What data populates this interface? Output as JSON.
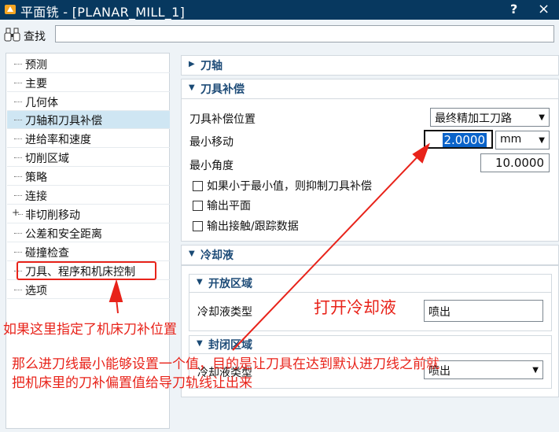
{
  "window": {
    "title": "平面铣 - [PLANAR_MILL_1]",
    "help_label": "?",
    "close_label": "×"
  },
  "find": {
    "label": "查找",
    "value": ""
  },
  "nav": {
    "items": [
      {
        "label": "预测"
      },
      {
        "label": "主要"
      },
      {
        "label": "几何体"
      },
      {
        "label": "刀轴和刀具补偿",
        "selected": true
      },
      {
        "label": "进给率和速度"
      },
      {
        "label": "切削区域"
      },
      {
        "label": "策略"
      },
      {
        "label": "连接"
      },
      {
        "label": "非切削移动",
        "expandable": true
      },
      {
        "label": "公差和安全距离"
      },
      {
        "label": "碰撞检查"
      },
      {
        "label": "刀具、程序和机床控制"
      },
      {
        "label": "选项"
      }
    ]
  },
  "sections": {
    "tool_axis": {
      "title": "刀轴"
    },
    "tool_comp": {
      "title": "刀具补偿",
      "position_label": "刀具补偿位置",
      "position_value": "最终精加工刀路",
      "min_move_label": "最小移动",
      "min_move_value": "2.0000",
      "min_move_unit": "mm",
      "min_angle_label": "最小角度",
      "min_angle_value": "10.0000",
      "check1": "如果小于最小值，则抑制刀具补偿",
      "check2": "输出平面",
      "check3": "输出接触/跟踪数据"
    },
    "coolant": {
      "title": "冷却液",
      "open_area": {
        "title": "开放区域",
        "type_label": "冷却液类型",
        "type_value": "喷出"
      },
      "closed_area": {
        "title": "封闭区域",
        "type_label": "冷却液类型",
        "type_value": "喷出"
      }
    }
  },
  "annotations": {
    "note1": "打开冷却液",
    "note2": "如果这里指定了机床刀补位置",
    "note3": "那么进刀线最小能够设置一个值，目的是让刀具在达到默认进刀线之前就",
    "note4": "把机床里的刀补偏置值给导刀轨线让出来",
    "color": "#e8231a"
  }
}
